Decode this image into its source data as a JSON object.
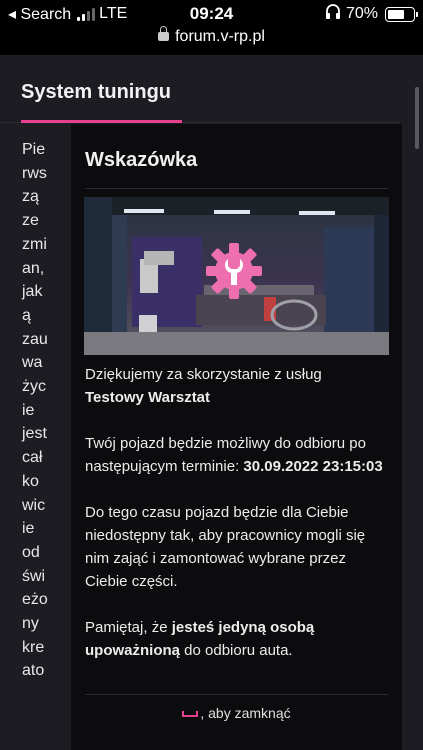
{
  "status_bar": {
    "carrier": "◂ Search",
    "network": "LTE",
    "time": "09:24",
    "battery": "70%",
    "battery_level": 0.7
  },
  "browser": {
    "url": "forum.v-rp.pl"
  },
  "page": {
    "heading": "System tuningu",
    "body_syllables": [
      "Pie",
      "rws",
      "zą",
      "ze",
      "zmi",
      "an,",
      "jak",
      "ą",
      "zau",
      "wa",
      "życ",
      "ie",
      "jest",
      "cał",
      "ko",
      "wic",
      "ie",
      "od",
      "świ",
      "eżo",
      "ny",
      "kre",
      "ato"
    ]
  },
  "tip": {
    "title": "Wskazówka",
    "thanks_text": "Dziękujemy za skorzystanie z usług",
    "workshop_name": "Testowy Warsztat",
    "pickup_text": "Twój pojazd będzie możliwy do odbioru po następującym terminie: ",
    "pickup_datetime": "30.09.2022 23:15:03",
    "unavailable_text": "Do tego czasu pojazd będzie dla Ciebie niedostępny tak, aby pracownicy mogli się nim zająć i zamontować wybrane przez Ciebie części.",
    "remember_prefix": "Pamiętaj, że ",
    "remember_bold1": "jesteś jedyną osobą",
    "remember_bold2": "upoważnioną",
    "remember_suffix": " do odbioru auta.",
    "close_hint": ", aby zamknąć",
    "accent_color": "#e6408e"
  },
  "icons": {
    "wrench_gear": "wrench-gear-icon",
    "lock": "lock-icon",
    "headphones": "headphones-icon",
    "space_key": "space-key-icon"
  }
}
